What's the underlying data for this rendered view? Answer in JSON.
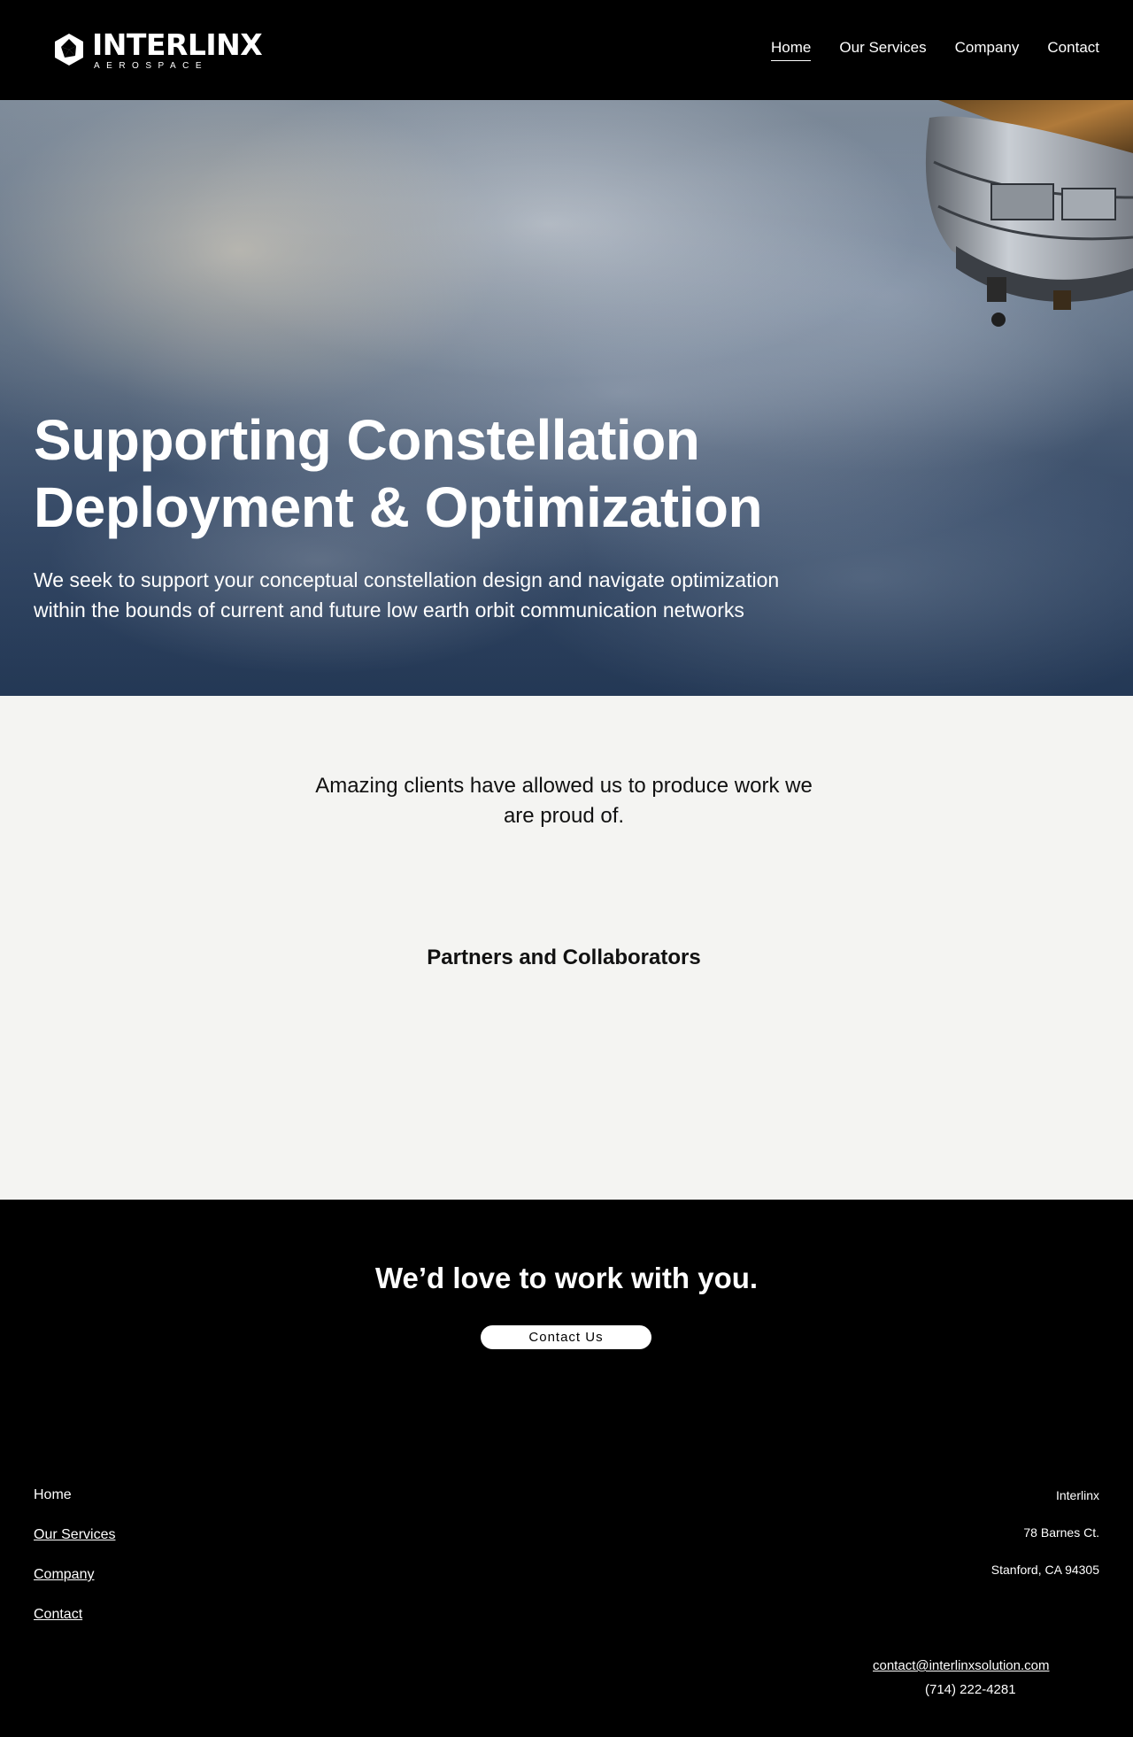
{
  "header": {
    "logo": {
      "word": "INTERLINX",
      "sub": "AEROSPACE"
    },
    "nav": [
      {
        "label": "Home",
        "active": true
      },
      {
        "label": "Our Services",
        "active": false
      },
      {
        "label": "Company",
        "active": false
      },
      {
        "label": "Contact",
        "active": false
      }
    ]
  },
  "hero": {
    "title_line1": "Supporting Constellation",
    "title_line2": "Deployment & Optimization",
    "subtitle_line1": "We seek to support your conceptual constellation design and navigate optimization",
    "subtitle_line2": "within the bounds of current and future low earth orbit communication networks"
  },
  "clients": {
    "text_line1": "Amazing clients have allowed us to produce work we",
    "text_line2": "are proud of.",
    "partners_heading": "Partners and Collaborators"
  },
  "cta": {
    "title": "We’d love to work with you.",
    "button_label": "Contact Us"
  },
  "footer": {
    "nav": [
      "Home",
      "Our Services",
      "Company",
      "Contact"
    ],
    "company": "Interlinx",
    "street": "78 Barnes Ct.",
    "city": "Stanford, CA 94305",
    "email": "contact@interlinxsolution.com",
    "phone": "(714) 222-4281"
  },
  "colors": {
    "background_dark": "#000000",
    "section_light": "#f4f4f2",
    "text_light": "#ffffff",
    "text_dark": "#111111"
  }
}
